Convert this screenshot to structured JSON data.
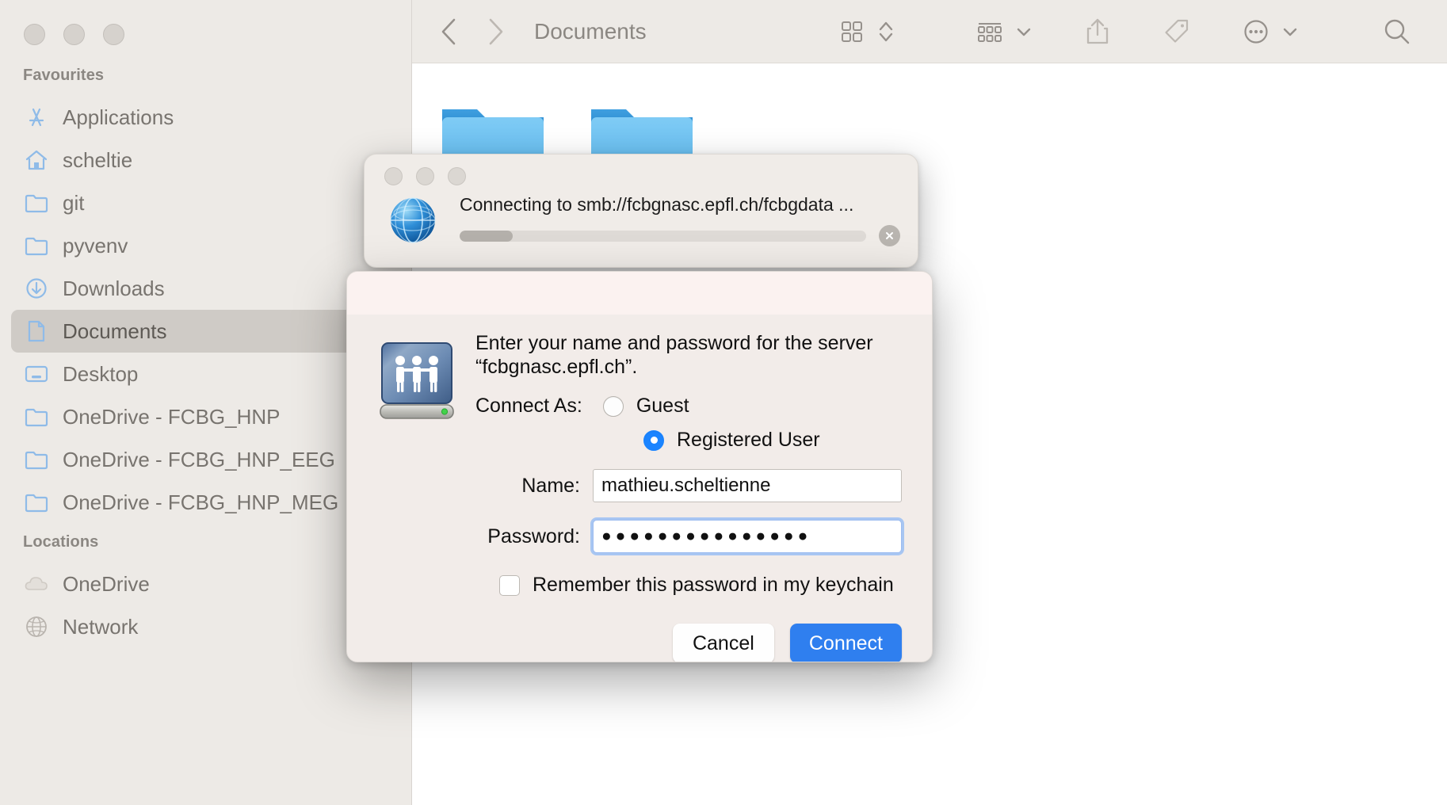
{
  "window": {
    "traffic_lights": [
      "close",
      "minimize",
      "zoom"
    ]
  },
  "toolbar": {
    "back_icon": "chevron-left-icon",
    "forward_icon": "chevron-right-icon",
    "title": "Documents",
    "view_icon": "grid-view-icon",
    "view_sort_icon": "updown-chevron-icon",
    "group_icon": "group-by-icon",
    "share_icon": "share-icon",
    "tag_icon": "tag-icon",
    "more_icon": "ellipsis-circle-icon",
    "search_icon": "search-icon"
  },
  "sidebar": {
    "sections": [
      {
        "title": "Favourites",
        "items": [
          {
            "label": "Applications",
            "icon": "applications-icon",
            "selected": false
          },
          {
            "label": "scheltie",
            "icon": "home-icon",
            "selected": false
          },
          {
            "label": "git",
            "icon": "folder-icon",
            "selected": false
          },
          {
            "label": "pyvenv",
            "icon": "folder-icon",
            "selected": false
          },
          {
            "label": "Downloads",
            "icon": "downloads-icon",
            "selected": false
          },
          {
            "label": "Documents",
            "icon": "document-icon",
            "selected": true
          },
          {
            "label": "Desktop",
            "icon": "desktop-icon",
            "selected": false
          },
          {
            "label": "OneDrive - FCBG_HNP",
            "icon": "folder-icon",
            "selected": false
          },
          {
            "label": "OneDrive - FCBG_HNP_EEG",
            "icon": "folder-icon",
            "selected": false
          },
          {
            "label": "OneDrive - FCBG_HNP_MEG",
            "icon": "folder-icon",
            "selected": false
          }
        ]
      },
      {
        "title": "Locations",
        "items": [
          {
            "label": "OneDrive",
            "icon": "cloud-icon",
            "selected": false
          },
          {
            "label": "Network",
            "icon": "globe-icon",
            "selected": false
          }
        ]
      }
    ]
  },
  "files": {
    "items": [
      {
        "icon": "folder-icon"
      },
      {
        "icon": "folder-icon"
      }
    ]
  },
  "progress_window": {
    "status_text": "Connecting to smb://fcbgnasc.epfl.ch/fcbgdata ...",
    "progress_percent": 13,
    "globe_icon": "globe-icon",
    "stop_icon": "stop-circle-icon"
  },
  "auth_dialog": {
    "server_icon": "file-server-icon",
    "message": "Enter your name and password for the server “fcbgnasc.epfl.ch”.",
    "connect_as_label": "Connect As:",
    "options": [
      {
        "label": "Guest",
        "selected": false
      },
      {
        "label": "Registered User",
        "selected": true
      }
    ],
    "name_label": "Name:",
    "name_value": "mathieu.scheltienne",
    "password_label": "Password:",
    "password_value": "●●●●●●●●●●●●●●●",
    "remember_label": "Remember this password in my keychain",
    "remember_checked": false,
    "cancel_label": "Cancel",
    "connect_label": "Connect",
    "accent_color": "#2f7fef"
  }
}
